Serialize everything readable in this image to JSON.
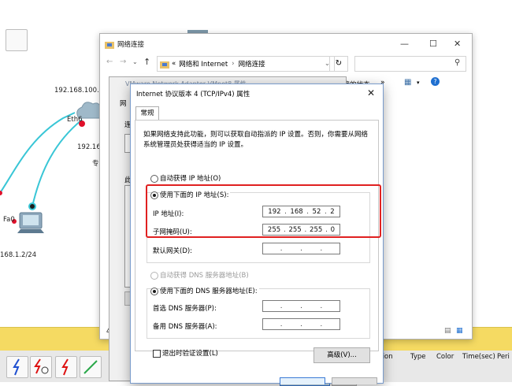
{
  "topology": {
    "labels": {
      "ip_top": "192.168.100.",
      "eth6": "Eth6",
      "ip_mid": "192.16",
      "partial": "专",
      "fa0": "Fa0",
      "ip_bottom": "168.1.2/24"
    }
  },
  "explorer": {
    "title": "网络连接",
    "breadcrumb_prefix": "«",
    "breadcrumb_1": "网络和 Internet",
    "breadcrumb_sep": "›",
    "breadcrumb_2": "网络连接",
    "cmd_text": "连接的状态",
    "cmd_more": "»",
    "left_letters": [
      "网",
      "连",
      "此"
    ],
    "bottom_left": "4"
  },
  "adapter": {
    "title": "VMware Network Adapter VMnet8 属性"
  },
  "dialog": {
    "title": "Internet 协议版本 4 (TCP/IPv4) 属性",
    "tab_general": "常规",
    "description": "如果网络支持此功能，则可以获取自动指派的 IP 设置。否则，你需要从网络系统管理员处获得适当的 IP 设置。",
    "auto_ip_label": "自动获得 IP 地址(O)",
    "manual_ip_label": "使用下面的 IP 地址(S):",
    "ip_address_label": "IP 地址(I):",
    "ip_address": [
      "192",
      "168",
      "52",
      "2"
    ],
    "subnet_label": "子网掩码(U):",
    "subnet_mask": [
      "255",
      "255",
      "255",
      "0"
    ],
    "gateway_label": "默认网关(D):",
    "auto_dns_label": "自动获得 DNS 服务器地址(B)",
    "manual_dns_label": "使用下面的 DNS 服务器地址(E):",
    "preferred_dns_label": "首选 DNS 服务器(P):",
    "alternate_dns_label": "备用 DNS 服务器(A):",
    "validate_label": "退出时验证设置(L)",
    "advanced_button": "高级(V)..."
  },
  "pdu_table": {
    "headers": [
      "ition",
      "Type",
      "Color",
      "Time(sec)",
      "Peri"
    ]
  },
  "colors": {
    "highlight_box": "#e02020",
    "link": "#39c6d6",
    "pt_yellow": "#f5da62"
  }
}
